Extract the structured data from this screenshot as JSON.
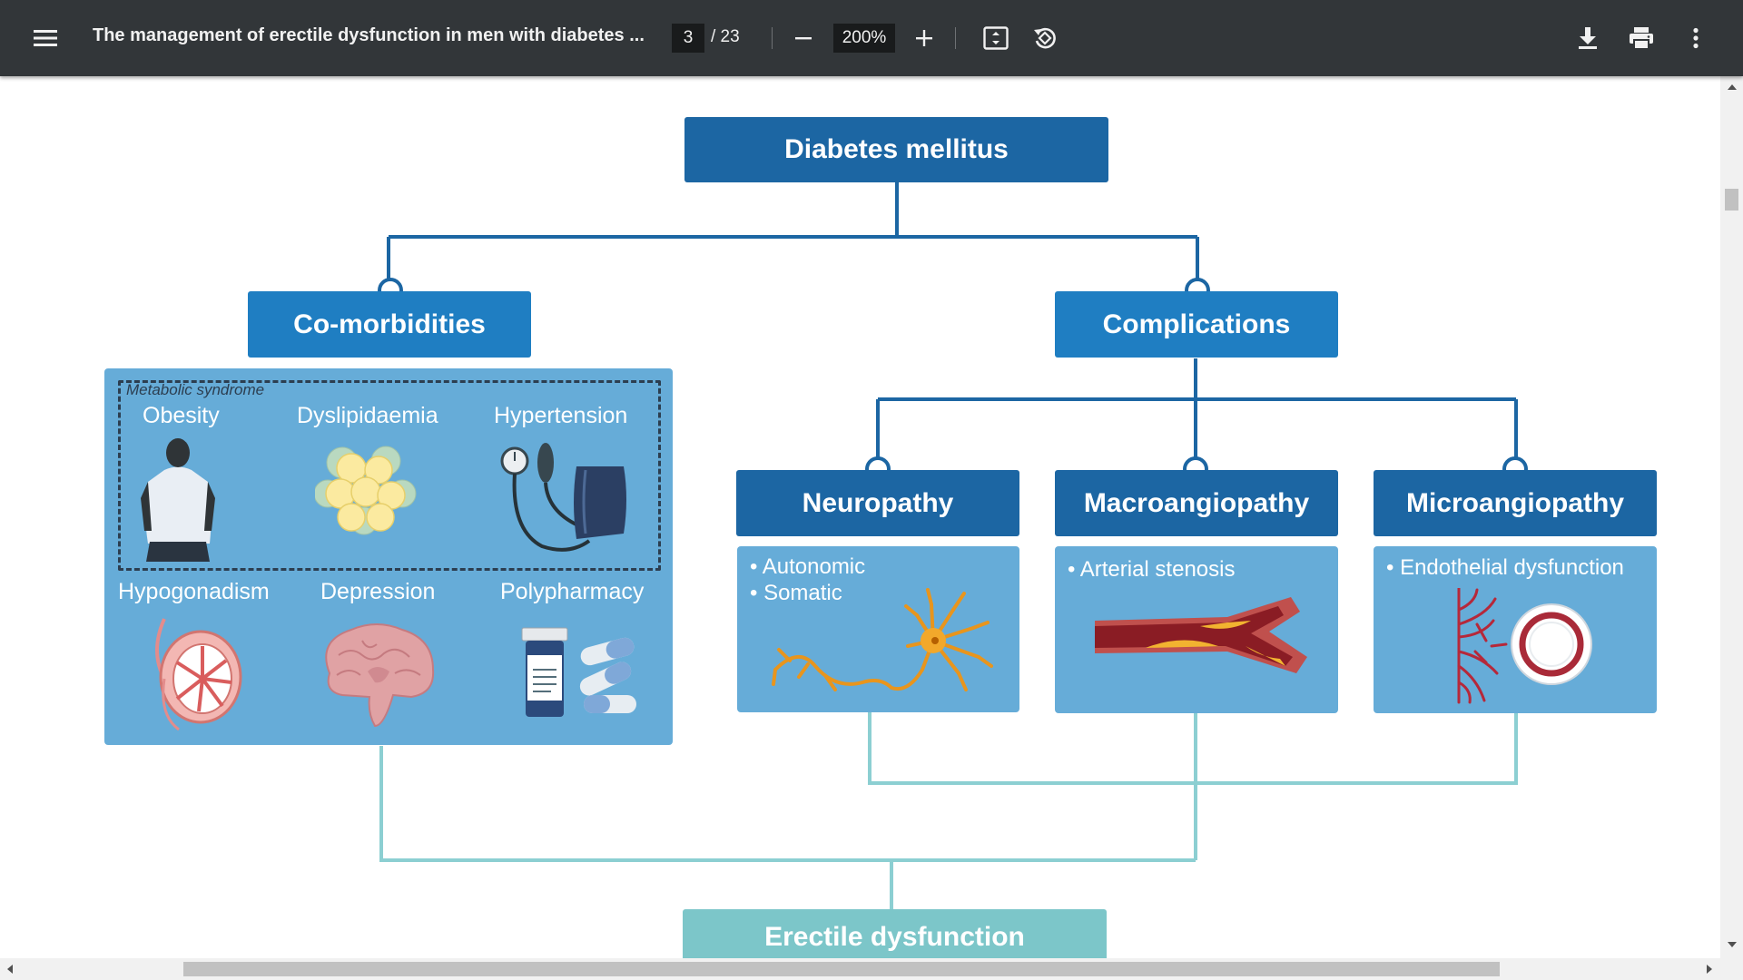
{
  "toolbar": {
    "menu_icon": "hamburger-menu-icon",
    "title": "The management of erectile dysfunction in men with diabetes ...",
    "current_page": "3",
    "page_total": "/ 23",
    "zoom": "200%",
    "icons": {
      "zoom_out": "minus-icon",
      "zoom_in": "plus-icon",
      "fit": "fit-to-page-icon",
      "rotate": "rotate-counterclockwise-icon",
      "download": "download-icon",
      "print": "printer-icon",
      "more": "more-vertical-icon"
    }
  },
  "diagram": {
    "root": "Diabetes mellitus",
    "comorbidities": {
      "title": "Co-morbidities",
      "metabolic_syndrome_label": "Metabolic syndrome",
      "items": [
        "Obesity",
        "Dyslipidaemia",
        "Hypertension",
        "Hypogonadism",
        "Depression",
        "Polypharmacy"
      ]
    },
    "complications": {
      "title": "Complications",
      "branches": [
        {
          "title": "Neuropathy",
          "bullets": [
            "• Autonomic",
            "• Somatic"
          ],
          "illustration": "neuron-illustration"
        },
        {
          "title": "Macroangiopathy",
          "bullets": [
            "• Arterial stenosis"
          ],
          "illustration": "stenosed-artery-illustration"
        },
        {
          "title": "Microangiopathy",
          "bullets": [
            "• Endothelial dysfunction"
          ],
          "illustration": "capillary-endothelium-illustration"
        }
      ]
    },
    "outcome": "Erectile dysfunction"
  },
  "colors": {
    "toolbar_bg": "#323639",
    "node_dark": "#1c66a3",
    "node_mid": "#1f7ec2",
    "panel": "#66acd8",
    "outcome": "#7cc6c9",
    "connector_dark": "#1c66a3",
    "connector_light": "#8ccfd2"
  }
}
